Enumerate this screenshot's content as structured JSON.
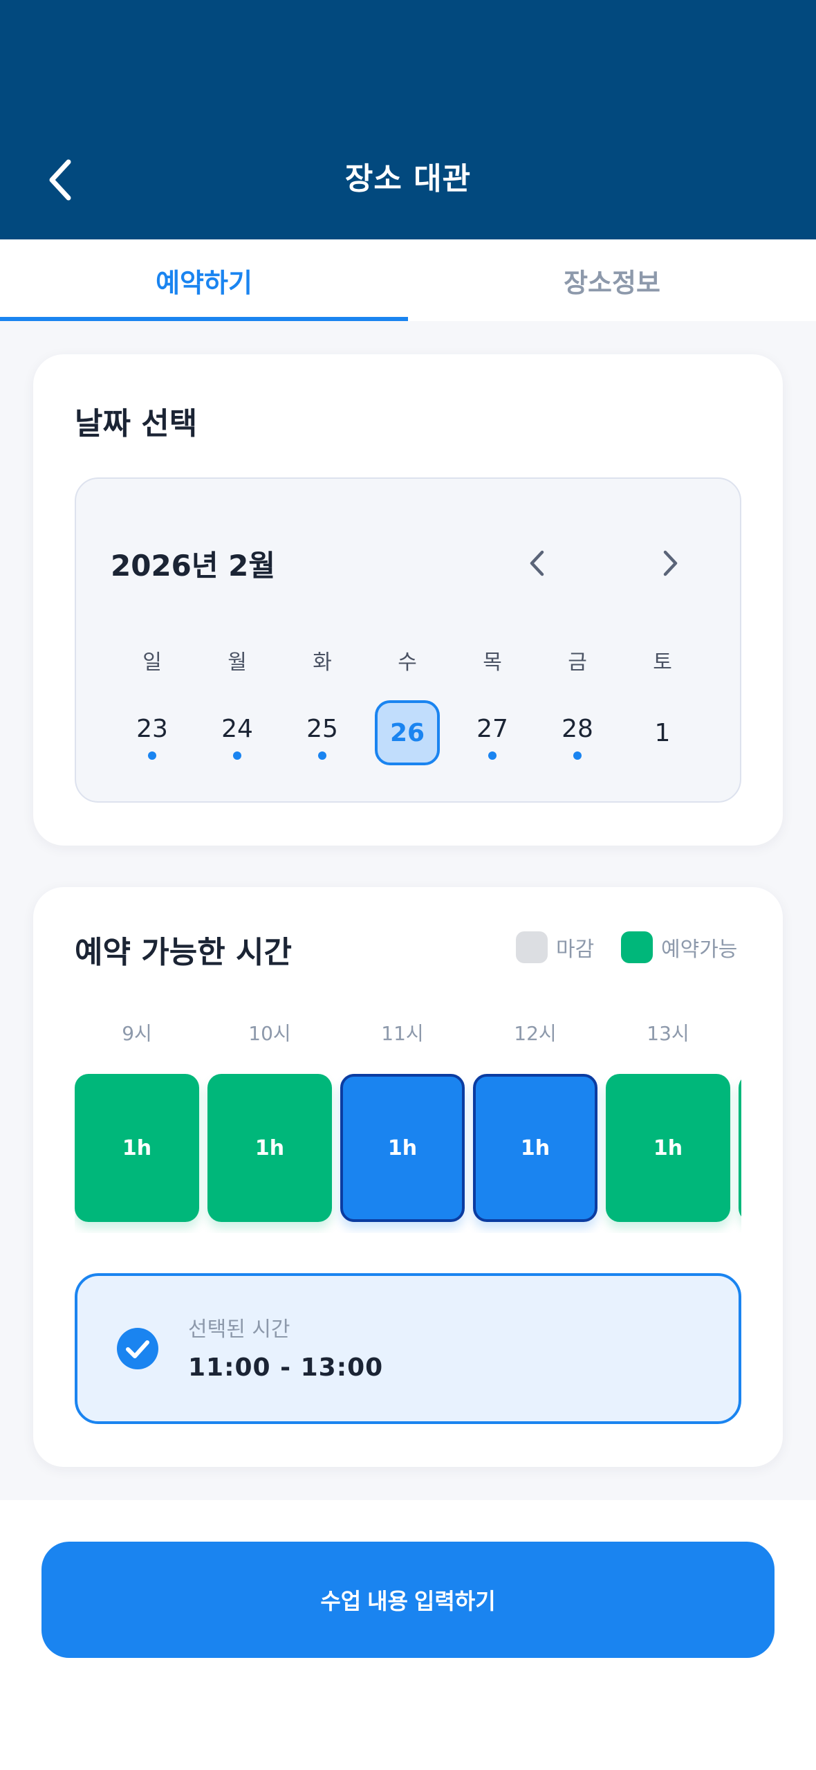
{
  "header": {
    "title": "장소 대관",
    "back_icon": "chevron-left-icon"
  },
  "tabs": [
    {
      "label": "예약하기",
      "active": true
    },
    {
      "label": "장소정보",
      "active": false
    }
  ],
  "date_card": {
    "title": "날짜 선택",
    "month_label": "2026년 2월",
    "weekdays": [
      "일",
      "월",
      "화",
      "수",
      "목",
      "금",
      "토"
    ],
    "days": [
      {
        "label": "23",
        "has_dot": true,
        "selected": false
      },
      {
        "label": "24",
        "has_dot": true,
        "selected": false
      },
      {
        "label": "25",
        "has_dot": true,
        "selected": false
      },
      {
        "label": "26",
        "has_dot": false,
        "selected": true
      },
      {
        "label": "27",
        "has_dot": true,
        "selected": false
      },
      {
        "label": "28",
        "has_dot": true,
        "selected": false
      },
      {
        "label": "1",
        "has_dot": false,
        "selected": false
      }
    ]
  },
  "time_card": {
    "title": "예약 가능한 시간",
    "legend": {
      "closed": "마감",
      "available": "예약가능"
    },
    "hours": [
      "9시",
      "10시",
      "11시",
      "12시",
      "13시"
    ],
    "slots": [
      {
        "label": "1h",
        "state": "available"
      },
      {
        "label": "1h",
        "state": "available"
      },
      {
        "label": "1h",
        "state": "selected"
      },
      {
        "label": "1h",
        "state": "selected"
      },
      {
        "label": "1h",
        "state": "available"
      },
      {
        "label": "",
        "state": "available"
      }
    ],
    "selected_caption": "선택된 시간",
    "selected_value": "11:00 - 13:00"
  },
  "bottom": {
    "button_label": "수업 내용 입력하기"
  },
  "colors": {
    "header_bg": "#02497e",
    "accent": "#1a84f0",
    "available": "#00b77a",
    "closed": "#dcdee2",
    "selected_border": "#0b3ca1"
  }
}
